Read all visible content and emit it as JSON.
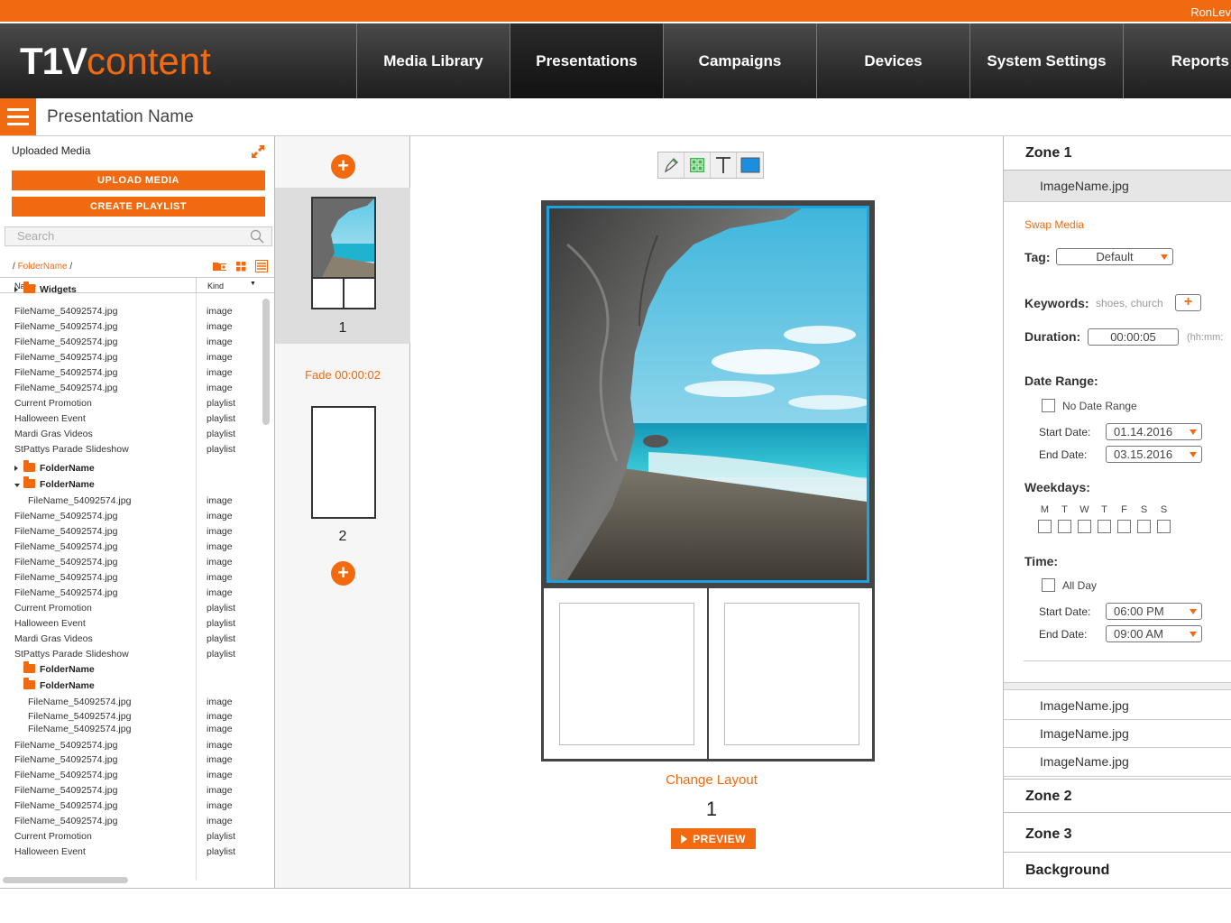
{
  "topbar": {
    "user": "RonLev"
  },
  "logo": {
    "bold": "T1V",
    "light": "content"
  },
  "nav": {
    "items": [
      {
        "label": "Media Library",
        "active": false
      },
      {
        "label": "Presentations",
        "active": true
      },
      {
        "label": "Campaigns",
        "active": false
      },
      {
        "label": "Devices",
        "active": false
      },
      {
        "label": "System Settings",
        "active": false
      },
      {
        "label": "Reports",
        "active": false
      }
    ]
  },
  "page": {
    "title": "Presentation Name"
  },
  "media": {
    "heading": "Uploaded Media",
    "upload_label": "UPLOAD MEDIA",
    "playlist_label": "CREATE PLAYLIST",
    "search_placeholder": "Search",
    "breadcrumb_folder": "FolderName",
    "col_name": "Name",
    "col_kind": "Kind",
    "rows": [
      {
        "name": "Widgets",
        "kind": "",
        "type": "folder",
        "tri": "r",
        "indent": 0
      },
      {
        "name": "FileName_54092574.jpg",
        "kind": "image",
        "type": "file",
        "indent": 0
      },
      {
        "name": "FileName_54092574.jpg",
        "kind": "image",
        "type": "file",
        "indent": 0
      },
      {
        "name": "FileName_54092574.jpg",
        "kind": "image",
        "type": "file",
        "indent": 0
      },
      {
        "name": "FileName_54092574.jpg",
        "kind": "image",
        "type": "file",
        "indent": 0
      },
      {
        "name": "FileName_54092574.jpg",
        "kind": "image",
        "type": "file",
        "indent": 0
      },
      {
        "name": "FileName_54092574.jpg",
        "kind": "image",
        "type": "file",
        "indent": 0
      },
      {
        "name": "Current Promotion",
        "kind": "playlist",
        "type": "file",
        "indent": 0
      },
      {
        "name": "Halloween Event",
        "kind": "playlist",
        "type": "file",
        "indent": 0
      },
      {
        "name": "Mardi Gras Videos",
        "kind": "playlist",
        "type": "file",
        "indent": 0
      },
      {
        "name": "StPattys Parade Slideshow",
        "kind": "playlist",
        "type": "file",
        "indent": 0
      },
      {
        "name": "FolderName",
        "kind": "",
        "type": "folder",
        "tri": "r",
        "indent": 0
      },
      {
        "name": "FolderName",
        "kind": "",
        "type": "folder",
        "tri": "d",
        "indent": 0
      },
      {
        "name": "FileName_54092574.jpg",
        "kind": "image",
        "type": "file",
        "indent": 1
      },
      {
        "name": "FileName_54092574.jpg",
        "kind": "image",
        "type": "file",
        "indent": 0
      },
      {
        "name": "FileName_54092574.jpg",
        "kind": "image",
        "type": "file",
        "indent": 0
      },
      {
        "name": "FileName_54092574.jpg",
        "kind": "image",
        "type": "file",
        "indent": 0
      },
      {
        "name": "FileName_54092574.jpg",
        "kind": "image",
        "type": "file",
        "indent": 0
      },
      {
        "name": "FileName_54092574.jpg",
        "kind": "image",
        "type": "file",
        "indent": 0
      },
      {
        "name": "FileName_54092574.jpg",
        "kind": "image",
        "type": "file",
        "indent": 0
      },
      {
        "name": "Current Promotion",
        "kind": "playlist",
        "type": "file",
        "indent": 0
      },
      {
        "name": "Halloween Event",
        "kind": "playlist",
        "type": "file",
        "indent": 0
      },
      {
        "name": "Mardi Gras Videos",
        "kind": "playlist",
        "type": "file",
        "indent": 0
      },
      {
        "name": "StPattys Parade Slideshow",
        "kind": "playlist",
        "type": "file",
        "indent": 0
      },
      {
        "name": "FolderName",
        "kind": "",
        "type": "folder",
        "tri": "",
        "indent": 0
      },
      {
        "name": "FolderName",
        "kind": "",
        "type": "folder",
        "tri": "",
        "indent": 0
      },
      {
        "name": "FileName_54092574.jpg",
        "kind": "image",
        "type": "file",
        "indent": 1
      },
      {
        "name": "FileName_54092574.jpg",
        "kind": "image",
        "type": "file",
        "indent": 1
      },
      {
        "name": "FileName_54092574.jpg",
        "kind": "image",
        "type": "file",
        "indent": 1
      },
      {
        "name": "FileName_54092574.jpg",
        "kind": "image",
        "type": "file",
        "indent": 0
      },
      {
        "name": "FileName_54092574.jpg",
        "kind": "image",
        "type": "file",
        "indent": 0
      },
      {
        "name": "FileName_54092574.jpg",
        "kind": "image",
        "type": "file",
        "indent": 0
      },
      {
        "name": "FileName_54092574.jpg",
        "kind": "image",
        "type": "file",
        "indent": 0
      },
      {
        "name": "FileName_54092574.jpg",
        "kind": "image",
        "type": "file",
        "indent": 0
      },
      {
        "name": "FileName_54092574.jpg",
        "kind": "image",
        "type": "file",
        "indent": 0
      },
      {
        "name": "Current Promotion",
        "kind": "playlist",
        "type": "file",
        "indent": 0
      },
      {
        "name": "Halloween Event",
        "kind": "playlist",
        "type": "file",
        "indent": 0
      }
    ]
  },
  "slides": {
    "items": [
      {
        "number": "1"
      },
      {
        "number": "2"
      }
    ],
    "transition": "Fade 00:00:02"
  },
  "canvas": {
    "change_layout": "Change Layout",
    "slide_number": "1",
    "preview_label": "PREVIEW"
  },
  "zone1": {
    "title": "Zone 1",
    "selected_media": "ImageName.jpg",
    "swap_media": "Swap Media",
    "tag_label": "Tag:",
    "tag_value": "Default",
    "keywords_label": "Keywords:",
    "keywords_value": "shoes, church",
    "keywords_add": "+",
    "duration_label": "Duration:",
    "duration_value": "00:00:05",
    "duration_hint": "(hh:mm:",
    "date_range_label": "Date Range:",
    "no_date_range": "No Date Range",
    "start_date_label": "Start Date:",
    "start_date_value": "01.14.2016",
    "end_date_label": "End Date:",
    "end_date_value": "03.15.2016",
    "weekdays_label": "Weekdays:",
    "weekdays": [
      "M",
      "T",
      "W",
      "T",
      "F",
      "S",
      "S"
    ],
    "time_label": "Time:",
    "all_day": "All Day",
    "time_start_label": "Start Date:",
    "time_start_value": "06:00 PM",
    "time_end_label": "End Date:",
    "time_end_value": "09:00 AM",
    "media_list": [
      "ImageName.jpg",
      "ImageName.jpg",
      "ImageName.jpg"
    ]
  },
  "zones": {
    "zone2": "Zone 2",
    "zone3": "Zone 3",
    "background": "Background"
  },
  "colors": {
    "accent": "#f26a10",
    "zone_highlight": "#1aa3e0"
  }
}
